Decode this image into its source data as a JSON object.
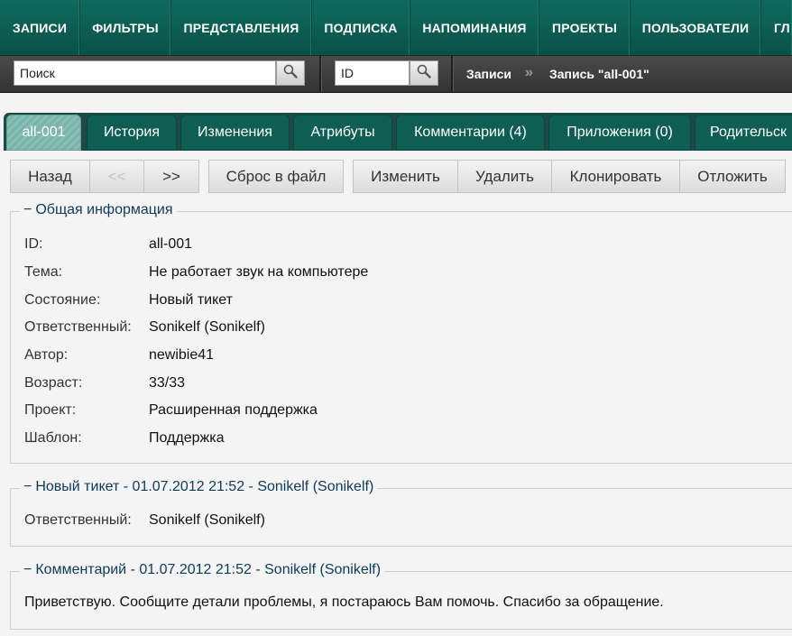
{
  "nav": {
    "items": [
      {
        "label": "ЗАПИСИ",
        "name": "nav-records"
      },
      {
        "label": "ФИЛЬТРЫ",
        "name": "nav-filters"
      },
      {
        "label": "ПРЕДСТАВЛЕНИЯ",
        "name": "nav-views"
      },
      {
        "label": "ПОДПИСКА",
        "name": "nav-subscription"
      },
      {
        "label": "НАПОМИНАНИЯ",
        "name": "nav-reminders"
      },
      {
        "label": "ПРОЕКТЫ",
        "name": "nav-projects"
      },
      {
        "label": "ПОЛЬЗОВАТЕЛИ",
        "name": "nav-users"
      },
      {
        "label": "ГЛ",
        "name": "nav-main-partial"
      }
    ]
  },
  "search": {
    "value": "Поиск",
    "id_value": "ID",
    "icon": "search-icon"
  },
  "breadcrumb": {
    "root": "Записи",
    "separator": "»",
    "current": "Запись \"all-001\""
  },
  "tabs": [
    {
      "label": "all-001"
    },
    {
      "label": "История"
    },
    {
      "label": "Изменения"
    },
    {
      "label": "Атрибуты"
    },
    {
      "label": "Комментарии (4)"
    },
    {
      "label": "Приложения (0)"
    },
    {
      "label": "Родительск"
    }
  ],
  "toolbar": {
    "back": "Назад",
    "prev": "<<",
    "next": ">>",
    "dump": "Сброс в файл",
    "edit": "Изменить",
    "delete": "Удалить",
    "clone": "Клонировать",
    "postpone": "Отложить"
  },
  "general": {
    "toggle": "−",
    "title": "Общая информация",
    "rows": [
      {
        "label": "ID:",
        "value": "all-001"
      },
      {
        "label": "Тема:",
        "value": "Не работает звук на компьютере"
      },
      {
        "label": "Состояние:",
        "value": "Новый тикет"
      },
      {
        "label": "Ответственный:",
        "value": "Sonikelf (Sonikelf)"
      },
      {
        "label": "Автор:",
        "value": "newibie41"
      },
      {
        "label": "Возраст:",
        "value": "33/33"
      },
      {
        "label": "Проект:",
        "value": "Расширенная поддержка"
      },
      {
        "label": "Шаблон:",
        "value": "Поддержка"
      }
    ]
  },
  "event": {
    "toggle": "−",
    "title": "Новый тикет - 01.07.2012 21:52 - Sonikelf (Sonikelf)",
    "label": "Ответственный:",
    "value": "Sonikelf (Sonikelf)"
  },
  "comment": {
    "toggle": "−",
    "title": "Комментарий - 01.07.2012 21:52 - Sonikelf (Sonikelf)",
    "text": "Приветствую. Сообщите детали проблемы, я постараюсь Вам помочь. Спасибо за обращение."
  },
  "colors": {
    "nav_bg": "#0f6a5e",
    "tab_bg": "#0f5e54",
    "tab_active": "#86bdb4",
    "legend_text": "#0e3a5a"
  }
}
